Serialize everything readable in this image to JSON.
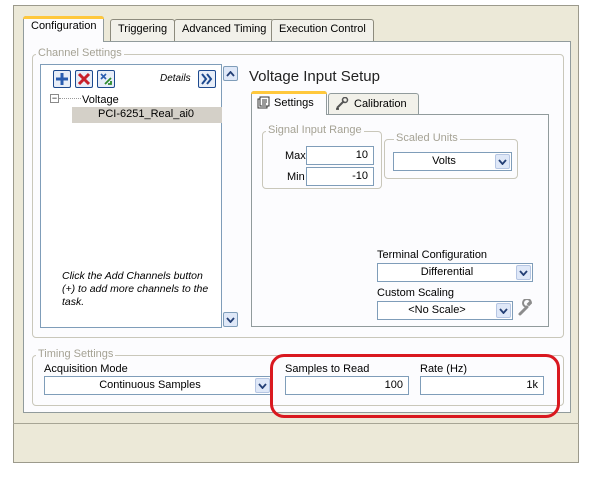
{
  "tabs": [
    "Configuration",
    "Triggering",
    "Advanced Timing",
    "Execution Control"
  ],
  "channel_settings": {
    "group_title": "Channel Settings",
    "details_label": "Details",
    "tree_root": "Voltage",
    "tree_item": "PCI-6251_Real_ai0",
    "hint": "Click the Add Channels button (+) to add more channels to the task."
  },
  "voltage_setup": {
    "title": "Voltage Input Setup",
    "tabs": [
      "Settings",
      "Calibration"
    ],
    "signal_input_range": {
      "title": "Signal Input Range",
      "max_label": "Max",
      "max_value": "10",
      "min_label": "Min",
      "min_value": "-10"
    },
    "scaled_units": {
      "title": "Scaled Units",
      "value": "Volts"
    },
    "terminal_config": {
      "label": "Terminal Configuration",
      "value": "Differential"
    },
    "custom_scaling": {
      "label": "Custom Scaling",
      "value": "<No Scale>"
    }
  },
  "timing": {
    "group_title": "Timing Settings",
    "acq_mode_label": "Acquisition Mode",
    "acq_mode_value": "Continuous Samples",
    "samples_label": "Samples to Read",
    "samples_value": "100",
    "rate_label": "Rate (Hz)",
    "rate_value": "1k"
  },
  "colors": {
    "highlight": "#d9181f",
    "active_tab_accent": "#ffc83c",
    "add_button": "#2a5db0",
    "remove_button": "#c8202a"
  },
  "icons": [
    "add-channel-icon",
    "remove-channel-icon",
    "channel-props-icon",
    "details-expand-icon",
    "settings-icon",
    "calibration-icon",
    "dropdown-arrow-icon",
    "wrench-icon"
  ]
}
